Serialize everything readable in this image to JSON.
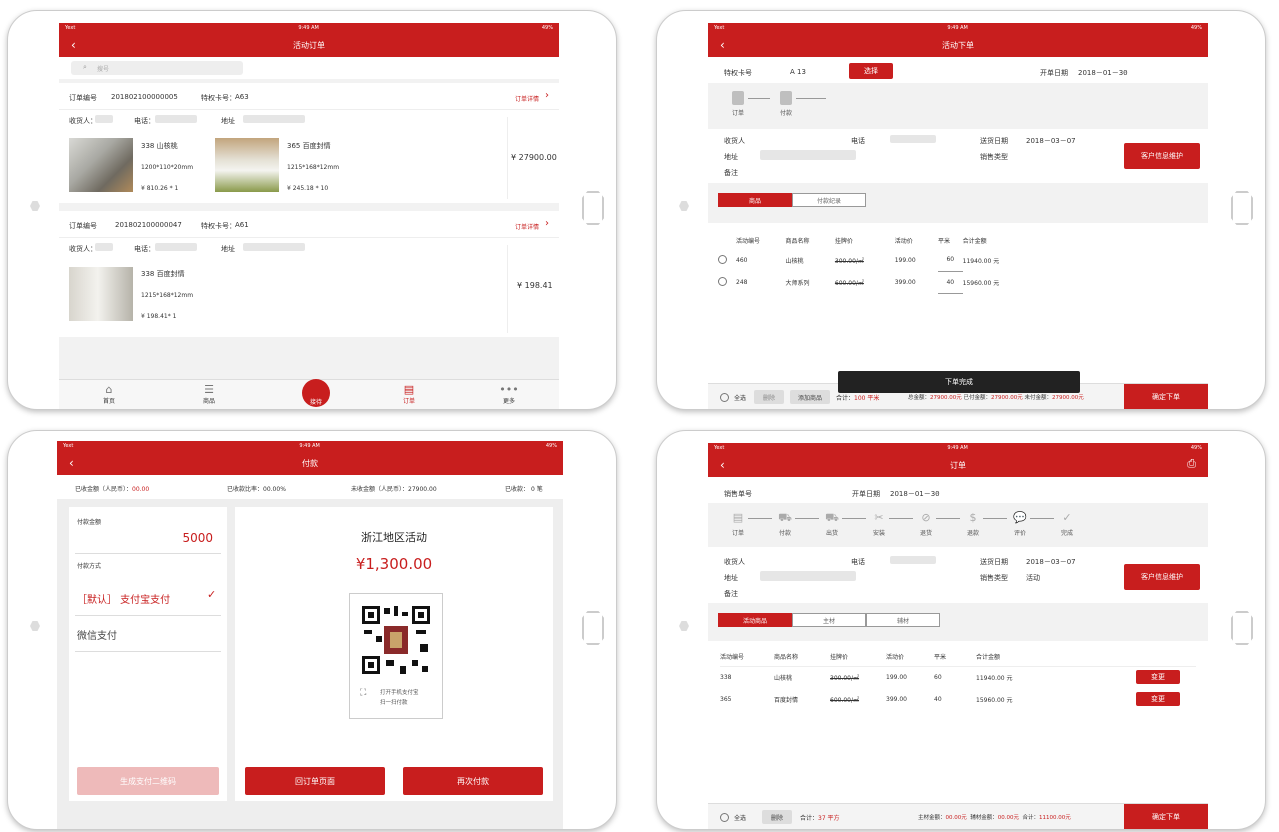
{
  "status": {
    "carrier": "Yext",
    "time": "9:49 AM",
    "battery": "49%"
  },
  "s1": {
    "title": "活动订单",
    "search_placeholder": "搜号",
    "orders": [
      {
        "no_label": "订单编号",
        "no": "201802100000005",
        "card_label": "特权卡号：",
        "card": "A63",
        "detail": "订单详情",
        "recv": "收货人：",
        "phone": "电话：",
        "addr": "地址",
        "total": "¥ 27900.00",
        "items": [
          {
            "name": "338 山核桃",
            "size": "1200*110*20mm",
            "price": "¥ 810.26 * 1"
          },
          {
            "name": "365 百度封情",
            "size": "1215*168*12mm",
            "price": "¥ 245.18 * 10"
          }
        ]
      },
      {
        "no_label": "订单编号",
        "no": "201802100000047",
        "card_label": "特权卡号：",
        "card": "A61",
        "detail": "订单详情",
        "recv": "收货人：",
        "phone": "电话：",
        "addr": "地址",
        "total": "¥ 198.41",
        "items": [
          {
            "name": "338 百度封情",
            "size": "1215*168*12mm",
            "price": "¥ 198.41* 1"
          }
        ]
      }
    ],
    "tabbar": [
      "首页",
      "商品",
      "接待",
      "订单",
      "更多"
    ]
  },
  "s2": {
    "title": "活动下单",
    "card_label": "特权卡号",
    "card": "A 13",
    "select": "选择",
    "date_label": "开单日期",
    "date": "2018－01－30",
    "steps": [
      "订单",
      "付款"
    ],
    "recv": "收货人",
    "phone": "电话",
    "addr": "地址",
    "note": "备注",
    "ship_label": "送货日期",
    "ship": "2018－03－07",
    "type_label": "销售类型",
    "maint": "客户信息维护",
    "tabs": [
      "商品",
      "付款纪录"
    ],
    "cols": [
      "活动编号",
      "商品名称",
      "挂牌价",
      "活动价",
      "平米",
      "合计金额"
    ],
    "rows": [
      [
        "460",
        "山核桃",
        "300.00/㎡",
        "199.00",
        "60",
        "11940.00 元"
      ],
      [
        "248",
        "大师系列",
        "600.00/㎡",
        "399.00",
        "40",
        "15960.00 元"
      ]
    ],
    "toast": "下单完成",
    "all": "全选",
    "del": "删除",
    "add": "添加商品",
    "sum_label": "合计：",
    "sum": "100 平米",
    "total_label": "总金额：",
    "total": "27900.00元",
    "paid_label": "已付金额：",
    "paid": "27900.00元",
    "unpaid_label": "未付金额：",
    "unpaid": "27900.00元",
    "confirm": "确定下单"
  },
  "s3": {
    "title": "付款",
    "received_label": "已收金额（人民币）：",
    "received": "00.00",
    "ratio_label": "已收款比率：",
    "ratio": "00.00%",
    "un_label": "未收金额（人民币）：",
    "un": "27900.00",
    "cnt_label": "已收款：",
    "cnt": "0",
    "cnt_unit": "笔",
    "amount_label": "付款金额",
    "amount": "5000",
    "method_label": "付款方式",
    "m1": "［默认］ 支付宝支付",
    "m2": "微信支付",
    "gen": "生成支付二维码",
    "event": "浙江地区活动",
    "price": "¥1,300.00",
    "scan1": "打开手机支付宝",
    "scan2": "扫一扫付款",
    "back_btn": "回订单页面",
    "again": "再次付款"
  },
  "s4": {
    "title": "订单",
    "no_label": "销售单号",
    "date_label": "开单日期",
    "date": "2018－01－30",
    "steps": [
      "订单",
      "付款",
      "出货",
      "安装",
      "退货",
      "退款",
      "评价",
      "完成"
    ],
    "recv": "收货人",
    "phone": "电话",
    "addr": "地址",
    "note": "备注",
    "ship_label": "送货日期",
    "ship": "2018－03－07",
    "type_label": "销售类型",
    "type": "活动",
    "maint": "客户信息维护",
    "tabs": [
      "活动商品",
      "主材",
      "辅材"
    ],
    "cols": [
      "活动编号",
      "商品名称",
      "挂牌价",
      "活动价",
      "平米",
      "合计金额"
    ],
    "rows": [
      [
        "338",
        "山核桃",
        "300.00/㎡",
        "199.00",
        "60",
        "11940.00 元"
      ],
      [
        "365",
        "百度封情",
        "600.00/㎡",
        "399.00",
        "40",
        "15960.00 元"
      ]
    ],
    "change": "变更",
    "all": "全选",
    "del": "删除",
    "sum_label": "合计：",
    "sum": "37 平方",
    "main_label": "主材金额：",
    "main": "00.00元",
    "aux_label": "辅材金额：",
    "aux": "00.00元",
    "total_label": "合计：",
    "total": "11100.00元",
    "confirm": "确定下单"
  },
  "colors": {
    "accent": "#c81e1e"
  }
}
